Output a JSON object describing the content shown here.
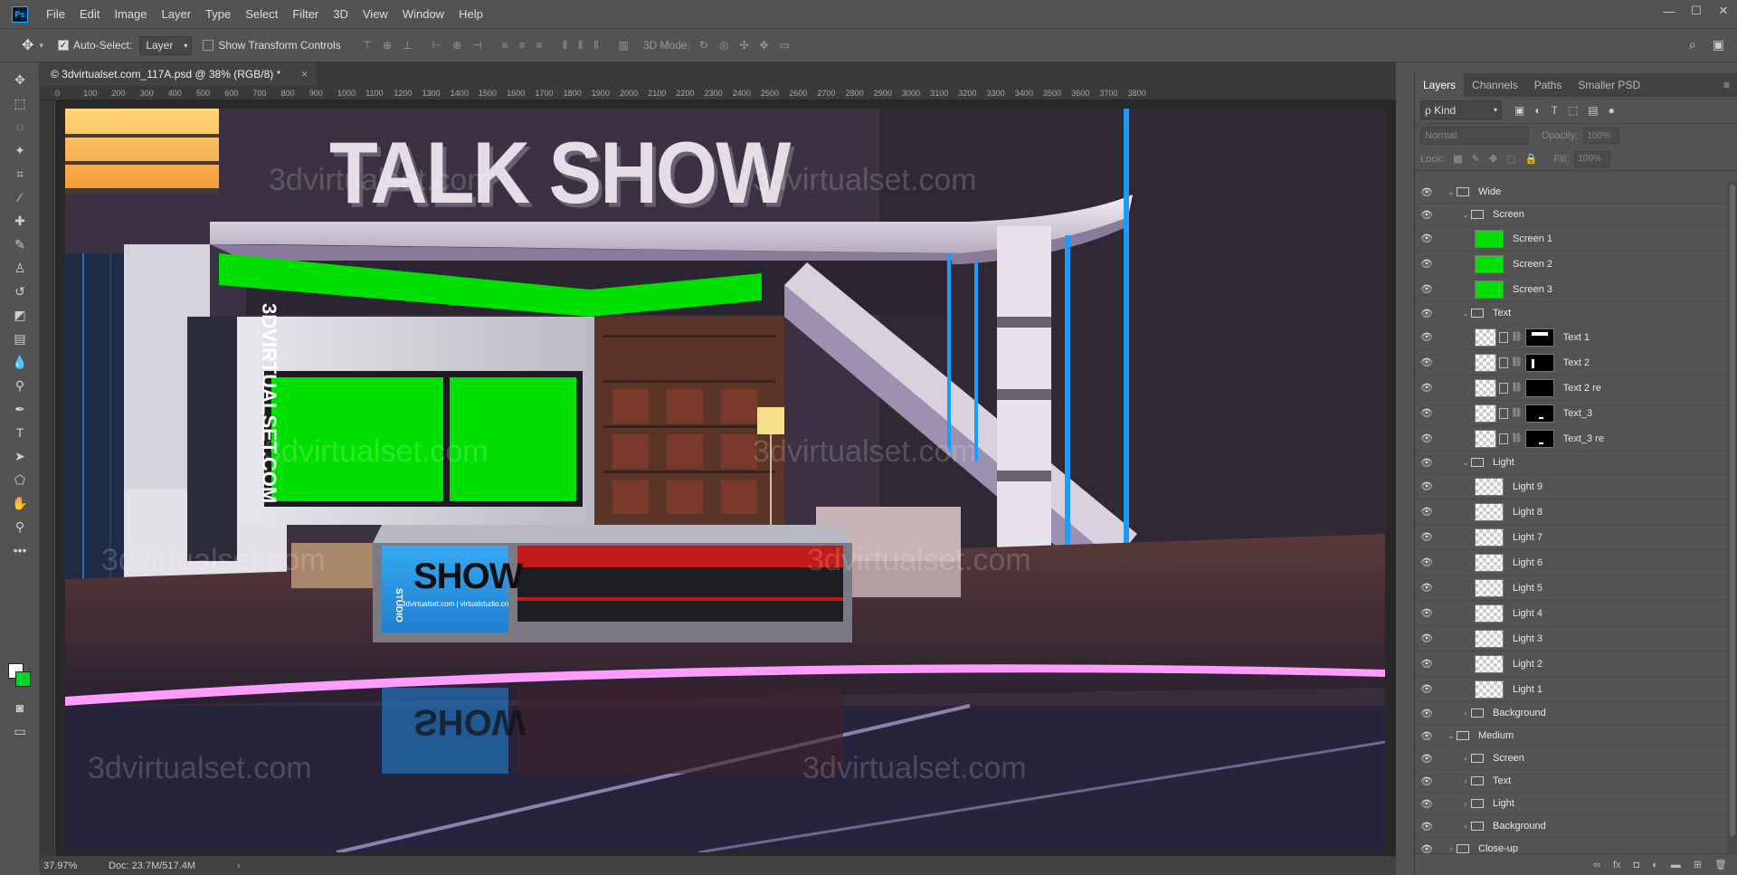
{
  "app": {
    "logo": "Ps"
  },
  "menu": [
    "File",
    "Edit",
    "Image",
    "Layer",
    "Type",
    "Select",
    "Filter",
    "3D",
    "View",
    "Window",
    "Help"
  ],
  "window_controls": [
    "—",
    "☐",
    "✕"
  ],
  "options": {
    "auto_select_label": "Auto-Select:",
    "auto_select_value": "Layer",
    "transform_label": "Show Transform Controls",
    "mode_3d_label": "3D Mode:"
  },
  "document": {
    "tab_title": "© 3dvirtualset.com_117A.psd @ 38% (RGB/8) *",
    "close": "×"
  },
  "ruler_ticks": [
    "0",
    "100",
    "200",
    "300",
    "400",
    "500",
    "600",
    "700",
    "800",
    "900",
    "1000",
    "1100",
    "1200",
    "1300",
    "1400",
    "1500",
    "1600",
    "1700",
    "1800",
    "1900",
    "2000",
    "2100",
    "2200",
    "2300",
    "2400",
    "2500",
    "2600",
    "2700",
    "2800",
    "2900",
    "3000",
    "3100",
    "3200",
    "3300",
    "3400",
    "3500",
    "3600",
    "3700",
    "3800"
  ],
  "scene": {
    "title": "TALK SHOW",
    "vertical_brand": "3DVIRTUALSET.COM",
    "desk_studio": "STUDIO",
    "desk_show": "SHOW",
    "desk_url": "3dvirtualset.com | virtualstudio.cn",
    "reflection_show": "SHOW",
    "watermark": "3dvirtualset.com"
  },
  "status": {
    "zoom": "37.97%",
    "doc": "Doc: 23.7M/517.4M"
  },
  "layers_panel": {
    "tabs": [
      "Layers",
      "Channels",
      "Paths",
      "Smaller PSD"
    ],
    "kind": "ρ Kind",
    "blend_mode": "Normal",
    "opacity_label": "Opacity:",
    "opacity_value": "100%",
    "lock_label": "Lock:",
    "fill_label": "Fill:",
    "fill_value": "100%",
    "layers": [
      {
        "name": "Wide",
        "type": "group",
        "depth": 0,
        "open": true
      },
      {
        "name": "Screen",
        "type": "group",
        "depth": 1,
        "open": true
      },
      {
        "name": "Screen 1",
        "type": "layer",
        "depth": 2,
        "thumb": "green"
      },
      {
        "name": "Screen 2",
        "type": "layer",
        "depth": 2,
        "thumb": "green"
      },
      {
        "name": "Screen 3",
        "type": "layer",
        "depth": 2,
        "thumb": "green"
      },
      {
        "name": "Text",
        "type": "group",
        "depth": 1,
        "open": true
      },
      {
        "name": "Text 1",
        "type": "smart",
        "depth": 2,
        "mask": "top"
      },
      {
        "name": "Text 2",
        "type": "smart",
        "depth": 2,
        "mask": "left"
      },
      {
        "name": "Text 2 re",
        "type": "smart",
        "depth": 2,
        "mask": "none"
      },
      {
        "name": "Text_3",
        "type": "smart",
        "depth": 2,
        "mask": "dot"
      },
      {
        "name": "Text_3 re",
        "type": "smart",
        "depth": 2,
        "mask": "dot"
      },
      {
        "name": "Light",
        "type": "group",
        "depth": 1,
        "open": true
      },
      {
        "name": "Light 9",
        "type": "layer",
        "depth": 2,
        "thumb": "checker"
      },
      {
        "name": "Light 8",
        "type": "layer",
        "depth": 2,
        "thumb": "checker"
      },
      {
        "name": "Light 7",
        "type": "layer",
        "depth": 2,
        "thumb": "checker"
      },
      {
        "name": "Light 6",
        "type": "layer",
        "depth": 2,
        "thumb": "checker"
      },
      {
        "name": "Light 5",
        "type": "layer",
        "depth": 2,
        "thumb": "checker"
      },
      {
        "name": "Light 4",
        "type": "layer",
        "depth": 2,
        "thumb": "checker"
      },
      {
        "name": "Light 3",
        "type": "layer",
        "depth": 2,
        "thumb": "checker"
      },
      {
        "name": "Light 2",
        "type": "layer",
        "depth": 2,
        "thumb": "checker"
      },
      {
        "name": "Light 1",
        "type": "layer",
        "depth": 2,
        "thumb": "checker"
      },
      {
        "name": "Background",
        "type": "group",
        "depth": 1,
        "open": false
      },
      {
        "name": "Medium",
        "type": "group",
        "depth": 0,
        "open": true
      },
      {
        "name": "Screen",
        "type": "group",
        "depth": 1,
        "open": false
      },
      {
        "name": "Text",
        "type": "group",
        "depth": 1,
        "open": false
      },
      {
        "name": "Light",
        "type": "group",
        "depth": 1,
        "open": false
      },
      {
        "name": "Background",
        "type": "group",
        "depth": 1,
        "open": false
      },
      {
        "name": "Close-up",
        "type": "group",
        "depth": 0,
        "open": false
      }
    ]
  },
  "colors": {
    "chroma_green": "#00e000",
    "ui_bg": "#535353",
    "canvas_bg": "#282828"
  }
}
